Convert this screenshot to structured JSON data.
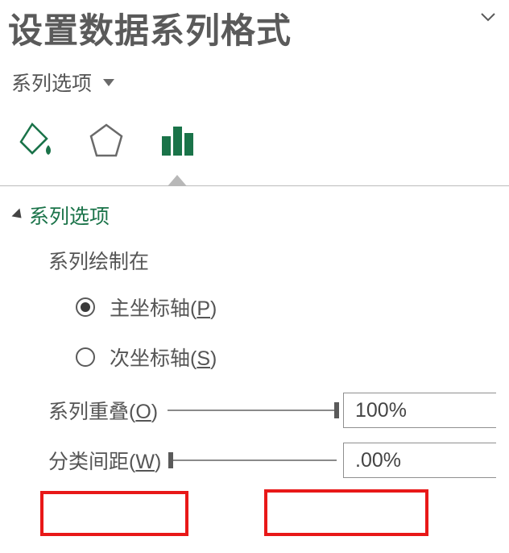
{
  "header": {
    "title": "设置数据系列格式"
  },
  "subnav": {
    "label": "系列选项"
  },
  "section": {
    "title": "系列选项",
    "plot_on_label": "系列绘制在",
    "radios": {
      "primary": "主坐标轴(",
      "primary_acc": "P",
      "secondary": "次坐标轴(",
      "secondary_acc": "S",
      "close": ")"
    },
    "overlap": {
      "label_pre": "系列重叠(",
      "acc": "O",
      "label_post": ")",
      "value": "100%"
    },
    "gap": {
      "label_pre": "分类间距(",
      "acc": "W",
      "label_post": ")",
      "value": ".00%"
    }
  }
}
